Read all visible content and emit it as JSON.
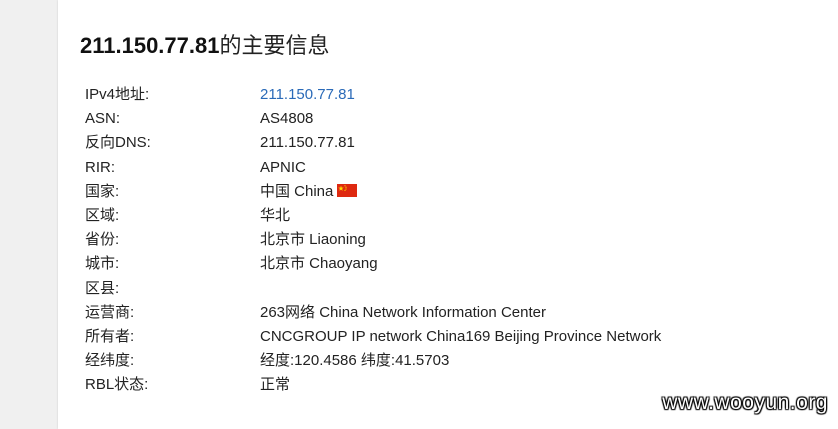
{
  "header": {
    "ip": "211.150.77.81",
    "suffix": "的主要信息"
  },
  "rows": [
    {
      "label": "IPv4地址:",
      "value": "211.150.77.81"
    },
    {
      "label": "ASN:",
      "value": "AS4808"
    },
    {
      "label": "反向DNS:",
      "value": "211.150.77.81"
    },
    {
      "label": "RIR:",
      "value": "APNIC"
    },
    {
      "label": "国家:",
      "value": "中国 China"
    },
    {
      "label": "区域:",
      "value": "华北"
    },
    {
      "label": "省份:",
      "value": "北京市 Liaoning"
    },
    {
      "label": "城市:",
      "value": "北京市 Chaoyang"
    },
    {
      "label": "区县:",
      "value": ""
    },
    {
      "label": "运营商:",
      "value": "263网络 China Network Information Center"
    },
    {
      "label": "所有者:",
      "value": "CNCGROUP IP network China169 Beijing Province Network"
    },
    {
      "label": "经纬度:",
      "value": "经度:120.4586 纬度:41.5703"
    },
    {
      "label": "RBL状态:",
      "value": "正常"
    }
  ],
  "flag_icon": "china-flag-icon",
  "colors": {
    "link": "#2a6ab8",
    "text": "#222222",
    "flag_red": "#de2910",
    "flag_star": "#ffde00"
  },
  "watermark": "www.wooyun.org"
}
